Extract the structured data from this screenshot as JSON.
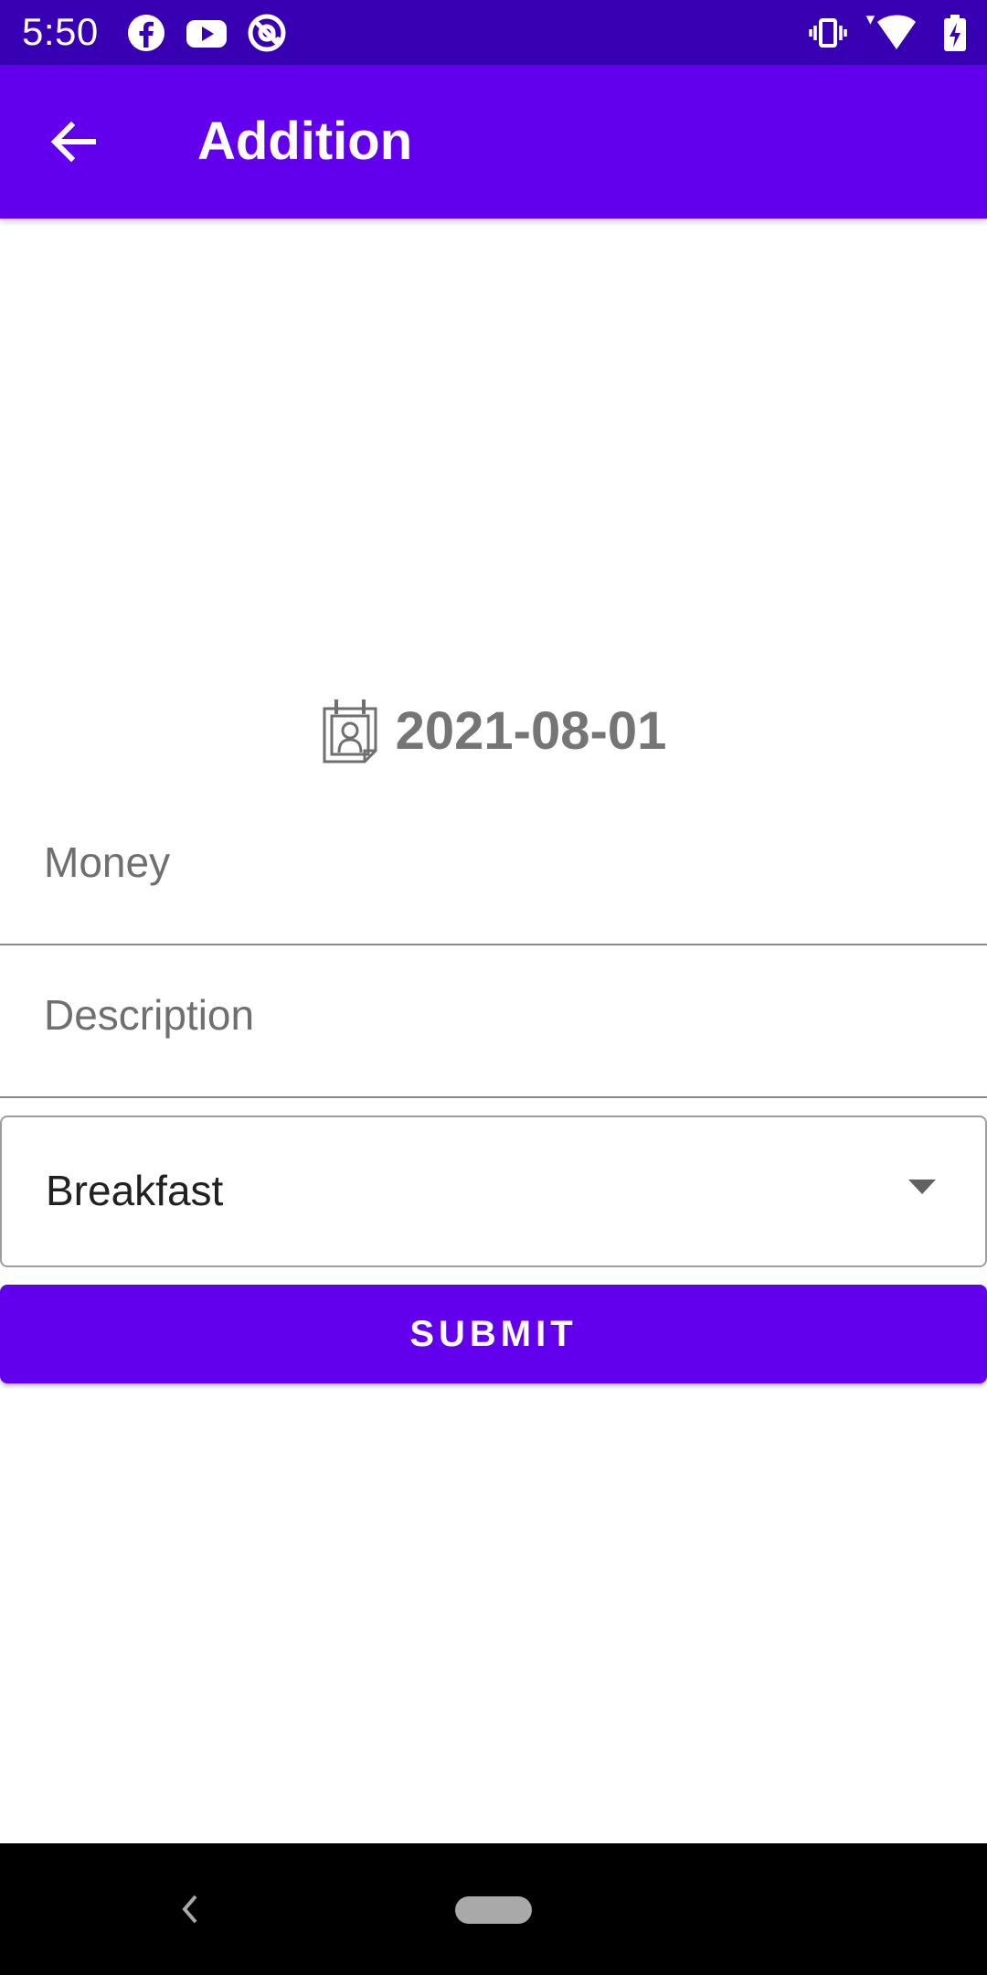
{
  "status_bar": {
    "time": "5:50",
    "left_icons": [
      "facebook-icon",
      "youtube-icon",
      "at-sign-icon"
    ],
    "right_icons": [
      "vibrate-icon",
      "wifi-icon",
      "battery-charging-icon"
    ],
    "background": "#3700b3"
  },
  "app_bar": {
    "title": "Addition",
    "back_icon": "arrow-left-icon",
    "background": "#6200ee"
  },
  "date_picker": {
    "icon": "calendar-icon",
    "value": "2021-08-01"
  },
  "form": {
    "money": {
      "value": "",
      "placeholder": "Money"
    },
    "description": {
      "value": "",
      "placeholder": "Description"
    },
    "category": {
      "selected": "Breakfast"
    },
    "submit_label": "SUBMIT"
  },
  "nav_bar": {
    "back_icon": "nav-back-icon",
    "home_icon": "nav-home-pill"
  },
  "colors": {
    "primary": "#6200ee",
    "primary_dark": "#3700b3",
    "hint_text": "#757575"
  }
}
